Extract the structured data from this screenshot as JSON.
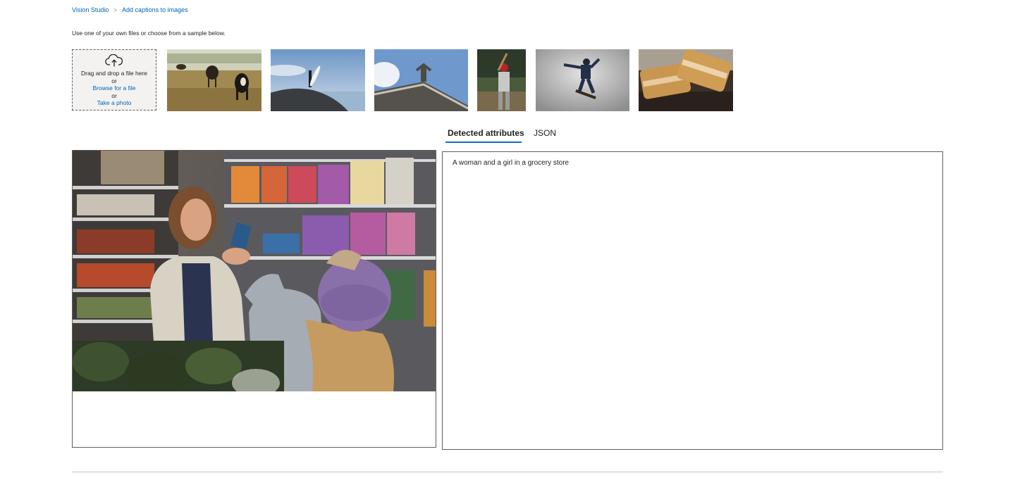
{
  "breadcrumb": {
    "root": "Vision Studio",
    "separator": ">",
    "current": "Add captions to images"
  },
  "intro": "Use one of your own files or choose from a sample below.",
  "upload": {
    "icon": "cloud-upload-icon",
    "drag_text": "Drag and drop a file here",
    "or_1": "or",
    "browse": "Browse for a file",
    "or_2": "or",
    "take_photo": "Take a photo"
  },
  "samples": [
    {
      "name": "sample-cows"
    },
    {
      "name": "sample-surfer"
    },
    {
      "name": "sample-building"
    },
    {
      "name": "sample-baseball"
    },
    {
      "name": "sample-skateboarder"
    },
    {
      "name": "sample-sandwich"
    }
  ],
  "tabs": [
    {
      "label": "Detected attributes",
      "active": true
    },
    {
      "label": "JSON",
      "active": false
    }
  ],
  "result": {
    "caption": "A woman and a girl in a grocery store"
  },
  "colors": {
    "link": "#0063b1",
    "accent": "#106ebe",
    "border": "#605e5c",
    "upload_bg": "#f3f2f1"
  }
}
